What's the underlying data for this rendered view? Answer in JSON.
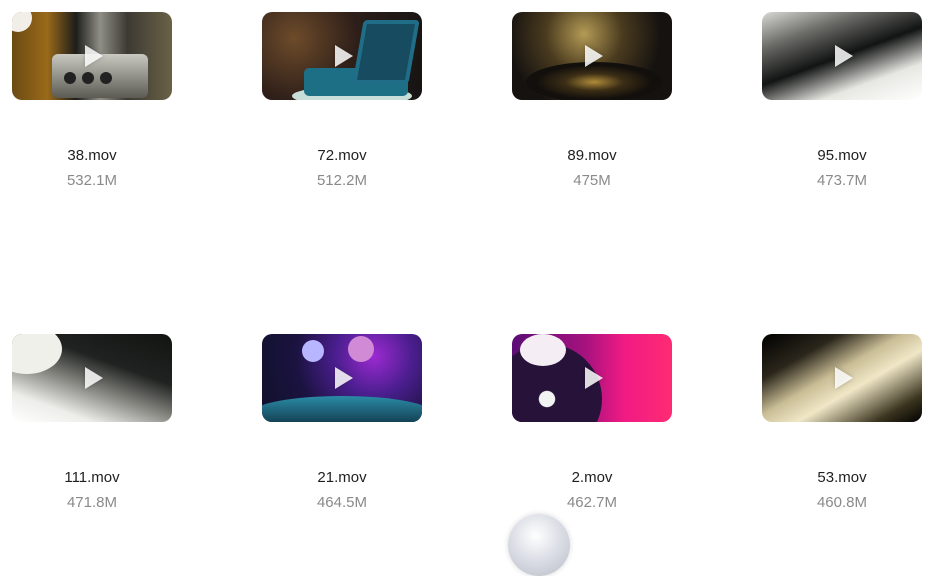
{
  "files": [
    {
      "name": "38.mov",
      "size": "532.1M",
      "thumb": "t1"
    },
    {
      "name": "72.mov",
      "size": "512.2M",
      "thumb": "t2"
    },
    {
      "name": "89.mov",
      "size": "475M",
      "thumb": "t3"
    },
    {
      "name": "95.mov",
      "size": "473.7M",
      "thumb": "t4"
    },
    {
      "name": "111.mov",
      "size": "471.8M",
      "thumb": "t5"
    },
    {
      "name": "21.mov",
      "size": "464.5M",
      "thumb": "t6"
    },
    {
      "name": "2.mov",
      "size": "462.7M",
      "thumb": "t7"
    },
    {
      "name": "53.mov",
      "size": "460.8M",
      "thumb": "t8"
    }
  ],
  "icons": {
    "play": "play-icon"
  },
  "colors": {
    "filename": "#1f1f1f",
    "filesize": "#8a8a8a",
    "background": "#ffffff"
  }
}
